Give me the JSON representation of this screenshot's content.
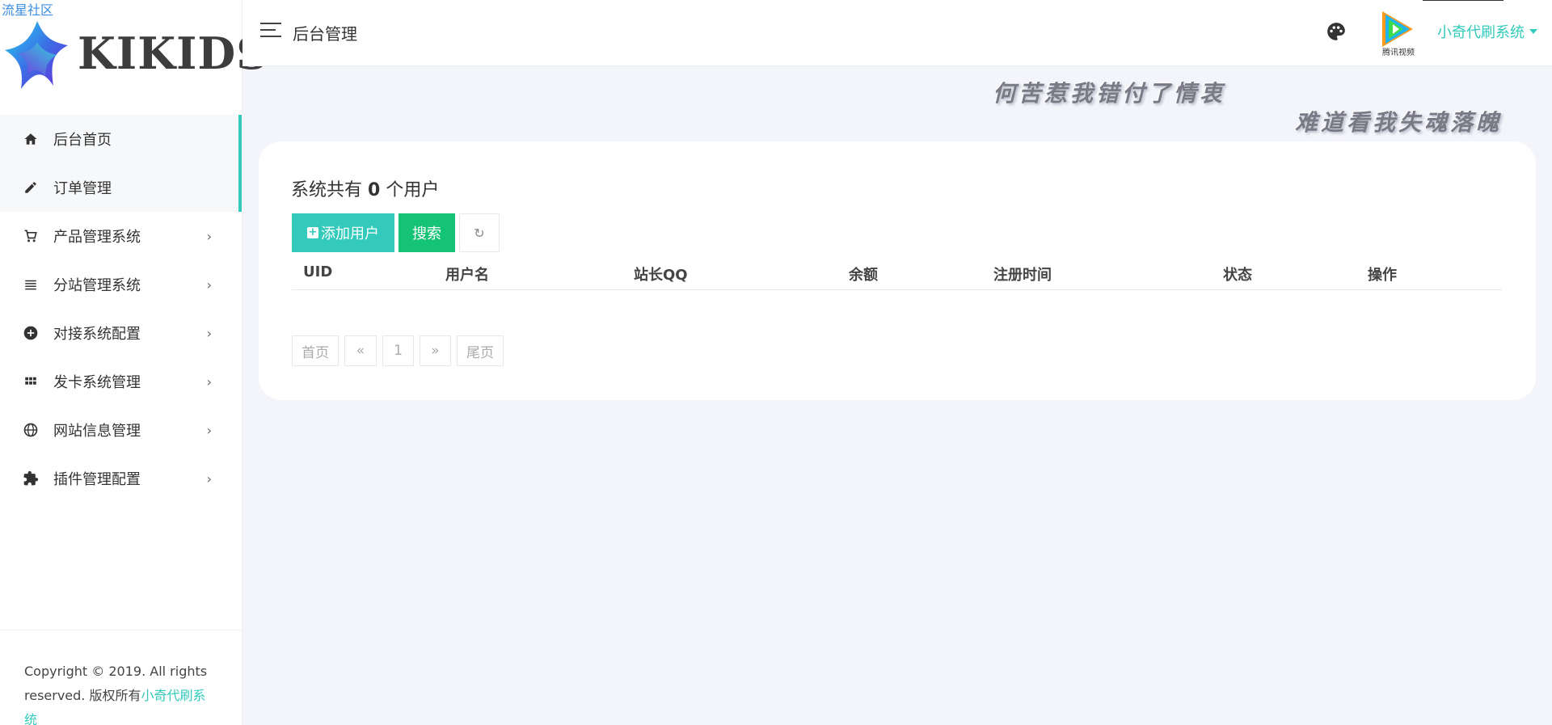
{
  "sidebar": {
    "brand_link": "流星社区",
    "logo_text": "KIKIDS",
    "items": [
      {
        "label": "后台首页",
        "icon": "home-icon",
        "has_submenu": false
      },
      {
        "label": "订单管理",
        "icon": "pencil-icon",
        "has_submenu": false
      },
      {
        "label": "产品管理系统",
        "icon": "cart-icon",
        "has_submenu": true
      },
      {
        "label": "分站管理系统",
        "icon": "list-icon",
        "has_submenu": true
      },
      {
        "label": "对接系统配置",
        "icon": "plus-circle-icon",
        "has_submenu": true
      },
      {
        "label": "发卡系统管理",
        "icon": "grid-icon",
        "has_submenu": true
      },
      {
        "label": "网站信息管理",
        "icon": "globe-icon",
        "has_submenu": true
      },
      {
        "label": "插件管理配置",
        "icon": "puzzle-icon",
        "has_submenu": true
      }
    ],
    "chevron": "›",
    "footer_text": "Copyright © 2019. All rights reserved. 版权所有",
    "footer_link": "小奇代刷系统"
  },
  "header": {
    "title": "后台管理",
    "user_name": "小奇代刷系统",
    "avatar_caption": "腾讯视频"
  },
  "banner": {
    "line1": "何苦惹我错付了情衷",
    "line2": "难道看我失魂落魄"
  },
  "main": {
    "summary_prefix": "系统共有",
    "user_count": "0",
    "summary_suffix": "个用户",
    "add_button": "添加用户",
    "search_button": "搜索",
    "refresh_icon": "↻",
    "columns": [
      "UID",
      "用户名",
      "站长QQ",
      "余额",
      "注册时间",
      "状态",
      "操作"
    ],
    "rows": [],
    "pagination": {
      "first": "首页",
      "prev": "«",
      "current": "1",
      "next": "»",
      "last": "尾页"
    }
  },
  "colors": {
    "accent": "#33cabb",
    "success": "#15c377",
    "background": "#f4f5fa"
  }
}
